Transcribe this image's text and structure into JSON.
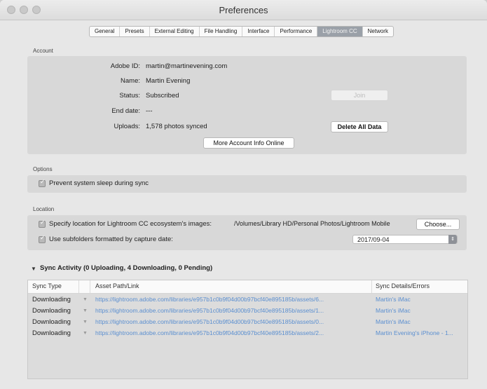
{
  "window": {
    "title": "Preferences"
  },
  "tabs": [
    "General",
    "Presets",
    "External Editing",
    "File Handling",
    "Interface",
    "Performance",
    "Lightroom CC",
    "Network"
  ],
  "active_tab": "Lightroom CC",
  "account": {
    "section_label": "Account",
    "rows": [
      {
        "label": "Adobe ID:",
        "value": "martin@martinevening.com"
      },
      {
        "label": "Name:",
        "value": "Martin Evening"
      },
      {
        "label": "Status:",
        "value": "Subscribed"
      },
      {
        "label": "End date:",
        "value": "---"
      },
      {
        "label": "Uploads:",
        "value": "1,578 photos synced"
      }
    ],
    "join_label": "Join",
    "delete_label": "Delete All Data",
    "more_info_label": "More Account Info Online"
  },
  "options": {
    "section_label": "Options",
    "prevent_sleep_label": "Prevent system sleep during sync",
    "prevent_sleep_checked": true
  },
  "location": {
    "section_label": "Location",
    "specify_label": "Specify location for Lightroom CC ecosystem's images:",
    "specify_checked": true,
    "path": "/Volumes/Library HD/Personal Photos/Lightroom Mobile",
    "choose_label": "Choose...",
    "subfolders_label": "Use subfolders formatted by capture date:",
    "subfolders_checked": true,
    "date_format": "2017/09-04"
  },
  "sync": {
    "title": "Sync Activity  (0 Uploading, 4 Downloading, 0 Pending)",
    "columns": [
      "Sync Type",
      "Asset Path/Link",
      "Sync Details/Errors"
    ],
    "rows": [
      {
        "type": "Downloading",
        "path": "https://lightroom.adobe.com/libraries/e957b1c0b9f04d00b97bcf40e895185b/assets/6...",
        "details": "Martin's iMac"
      },
      {
        "type": "Downloading",
        "path": "https://lightroom.adobe.com/libraries/e957b1c0b9f04d00b97bcf40e895185b/assets/1...",
        "details": "Martin's iMac"
      },
      {
        "type": "Downloading",
        "path": "https://lightroom.adobe.com/libraries/e957b1c0b9f04d00b97bcf40e895185b/assets/0...",
        "details": "Martin's iMac"
      },
      {
        "type": "Downloading",
        "path": "https://lightroom.adobe.com/libraries/e957b1c0b9f04d00b97bcf40e895185b/assets/2...",
        "details": "Martin Evening's iPhone - 1..."
      }
    ]
  },
  "icons": {
    "row_toggle": "triangle-down-icon",
    "disclosure": "disclosure-triangle-icon",
    "checkbox": "checkmark-icon",
    "stepper": "stepper-arrows-icon"
  },
  "colors": {
    "link": "#5b8fd0",
    "active_tab": "#9aa0a8"
  }
}
